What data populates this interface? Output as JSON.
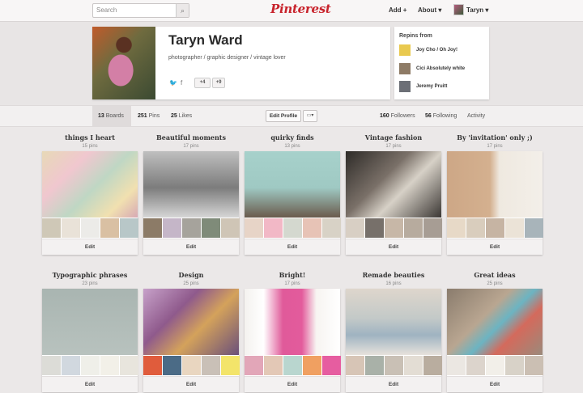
{
  "header": {
    "search_placeholder": "Search",
    "logo": "Pinterest",
    "nav": {
      "add": "Add +",
      "about": "About ▾",
      "user": "Taryn ▾"
    }
  },
  "profile": {
    "name": "Taryn Ward",
    "bio": "photographer / graphic designer / vintage lover",
    "buttons": {
      "fb_like": "+4",
      "plus_one": "+9"
    }
  },
  "repins": {
    "title": "Repins from",
    "users": [
      {
        "name": "Joy Cho / Oh Joy!"
      },
      {
        "name": "Cici Absolutely white"
      },
      {
        "name": "Jeremy Pruitt"
      }
    ]
  },
  "stats": {
    "boards": {
      "count": "13",
      "label": "Boards"
    },
    "pins": {
      "count": "251",
      "label": "Pins"
    },
    "likes": {
      "count": "25",
      "label": "Likes"
    },
    "edit_profile": "Edit Profile",
    "followers": {
      "count": "160",
      "label": "Followers"
    },
    "following": {
      "count": "56",
      "label": "Following"
    },
    "activity": "Activity"
  },
  "boards": [
    {
      "title": "things I heart",
      "count": "15 pins",
      "edit": "Edit",
      "cover": "linear-gradient(135deg,#e7d9b7 0%,#f0c7cf 30%,#bfd7c4 55%,#f1e0b0 80%,#d7a9b4 100%)",
      "thumbs": [
        "#cfc8b7",
        "#e9e2d8",
        "#ecebe8",
        "#d9c0a3",
        "#b8c7c8"
      ]
    },
    {
      "title": "Beautiful moments",
      "count": "17 pins",
      "edit": "Edit",
      "cover": "linear-gradient(180deg,#bfbfbf 0%,#7c7c7c 55%,#d6d6d6 100%)",
      "thumbs": [
        "#8c7b67",
        "#c5b6c8",
        "#a6a39c",
        "#7f8b79",
        "#cfc5b6"
      ]
    },
    {
      "title": "quirky finds",
      "count": "13 pins",
      "edit": "Edit",
      "cover": "linear-gradient(180deg,#a7d1cb 0%,#9fc9c3 55%,#6a5a4c 100%)",
      "thumbs": [
        "#e7d4c7",
        "#f2b8c6",
        "#d4d8cf",
        "#e7c3b6",
        "#d8d2c6"
      ]
    },
    {
      "title": "Vintage fashion",
      "count": "17 pins",
      "edit": "Edit",
      "cover": "linear-gradient(135deg,#2e2b28 0%,#7a7068 40%,#d7d1c7 60%,#3b3734 100%)",
      "thumbs": [
        "#d8cfc4",
        "#77706a",
        "#c7b7a7",
        "#b7ab9e",
        "#a79d94"
      ]
    },
    {
      "title": "By 'invitation' only ;)",
      "count": "17 pins",
      "edit": "Edit",
      "cover": "linear-gradient(90deg,#cda786 0%,#d4b08f 45%,#efe9e0 55%,#f3efe9 100%)",
      "thumbs": [
        "#e7d9c7",
        "#d9cdbd",
        "#c6b4a3",
        "#ebe3d7",
        "#a8b4ba"
      ]
    },
    {
      "title": "Typographic phrases",
      "count": "23 pins",
      "edit": "Edit",
      "cover": "linear-gradient(180deg,#a9b5b1 0%,#b8c2be 100%)",
      "thumbs": [
        "#dcdcd7",
        "#d1d8df",
        "#efefe9",
        "#f2f0e8",
        "#e8e5dd"
      ]
    },
    {
      "title": "Design",
      "count": "25 pins",
      "edit": "Edit",
      "cover": "linear-gradient(135deg,#c7a1c9 0%,#8f5a8c 35%,#d4a25b 60%,#6a4f7a 100%)",
      "thumbs": [
        "#e05c3c",
        "#4b6b86",
        "#e9d6c0",
        "#c9c0b7",
        "#f3e46a"
      ]
    },
    {
      "title": "Bright!",
      "count": "17 pins",
      "edit": "Edit",
      "cover": "linear-gradient(90deg,#f4f2ef 0%,#ffffff 20%,#e05a9a 40%,#e35b9c 60%,#f7f4f1 75%,#ffffff 100%)",
      "thumbs": [
        "#e2a6b8",
        "#e3c8b6",
        "#b9d6cf",
        "#f0a061",
        "#e65da0"
      ]
    },
    {
      "title": "Remade beauties",
      "count": "16 pins",
      "edit": "Edit",
      "cover": "linear-gradient(180deg,#ded6cc 0%,#c3c9c8 45%,#9fb3c1 70%,#e7e2dc 100%)",
      "thumbs": [
        "#d7c5b6",
        "#a9b1a8",
        "#c9c0b5",
        "#e3ddd4",
        "#b9ad9f"
      ]
    },
    {
      "title": "Great ideas",
      "count": "25 pins",
      "edit": "Edit",
      "cover": "linear-gradient(135deg,#8a7c6d 0%,#b9a691 40%,#6cb4c2 55%,#d46a5c 70%,#9a8a7b 100%)",
      "thumbs": [
        "#ebe7e2",
        "#dcd4cc",
        "#f2efe9",
        "#d8d2c8",
        "#cbbfb3"
      ]
    }
  ]
}
